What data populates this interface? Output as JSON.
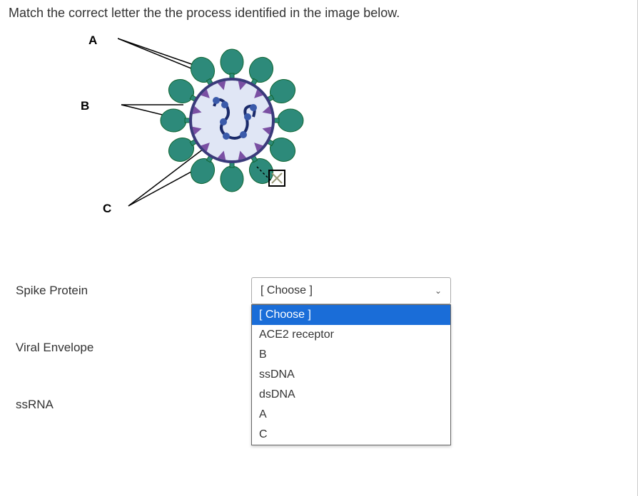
{
  "question_text": "Match the correct letter the the process identified in the image below.",
  "image_labels": {
    "a": "A",
    "b": "B",
    "c": "C"
  },
  "rows": [
    {
      "label": "Spike Protein"
    },
    {
      "label": "Viral Envelope"
    },
    {
      "label": "ssRNA"
    }
  ],
  "select": {
    "placeholder": "[ Choose ]",
    "options": [
      "[ Choose ]",
      "ACE2 receptor",
      "B",
      "ssDNA",
      "dsDNA",
      "A",
      "C"
    ]
  }
}
